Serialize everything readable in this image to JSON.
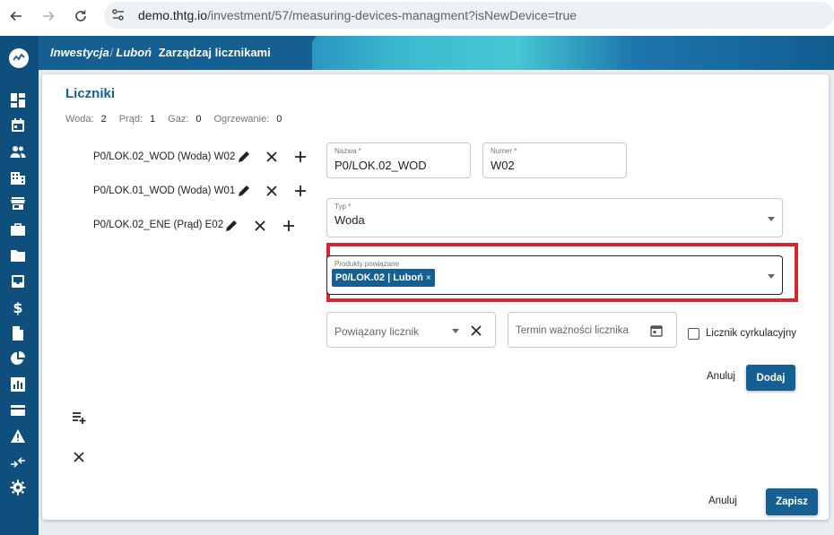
{
  "browser": {
    "url_host": "demo.thtg.io",
    "url_path": "/investment/57/measuring-devices-managment?isNewDevice=true"
  },
  "header": {
    "crumb_1": "Inwestycja",
    "crumb_2": "Luboń",
    "crumb_3": "Zarządzaj licznikami"
  },
  "page": {
    "title": "Liczniki",
    "counts": [
      {
        "label": "Woda:",
        "value": "2"
      },
      {
        "label": "Prąd:",
        "value": "1"
      },
      {
        "label": "Gaz:",
        "value": "0"
      },
      {
        "label": "Ogrzewanie:",
        "value": "0"
      }
    ]
  },
  "devices": [
    {
      "label": "P0/LOK.02_WOD (Woda) W02"
    },
    {
      "label": "P0/LOK.01_WOD (Woda) W01"
    },
    {
      "label": "P0/LOK.02_ENE (Prąd) E02"
    }
  ],
  "form": {
    "name_label": "Nazwa *",
    "name_value": "P0/LOK.02_WOD",
    "number_label": "Numer *",
    "number_value": "W02",
    "type_label": "Typ *",
    "type_value": "Woda",
    "products_label": "Produkty powiązane",
    "product_chip": "P0/LOK.02 | Luboń",
    "chip_remove": "×",
    "linked_meter_placeholder": "Powiązany licznik",
    "expiry_placeholder": "Termin ważności licznika",
    "circulation_label": "Licznik cyrkulacyjny",
    "cancel_label": "Anuluj",
    "add_label": "Dodaj"
  },
  "footer": {
    "cancel_label": "Anuluj",
    "save_label": "Zapisz"
  },
  "colors": {
    "brand": "#165f93",
    "highlight": "#d9252b"
  }
}
